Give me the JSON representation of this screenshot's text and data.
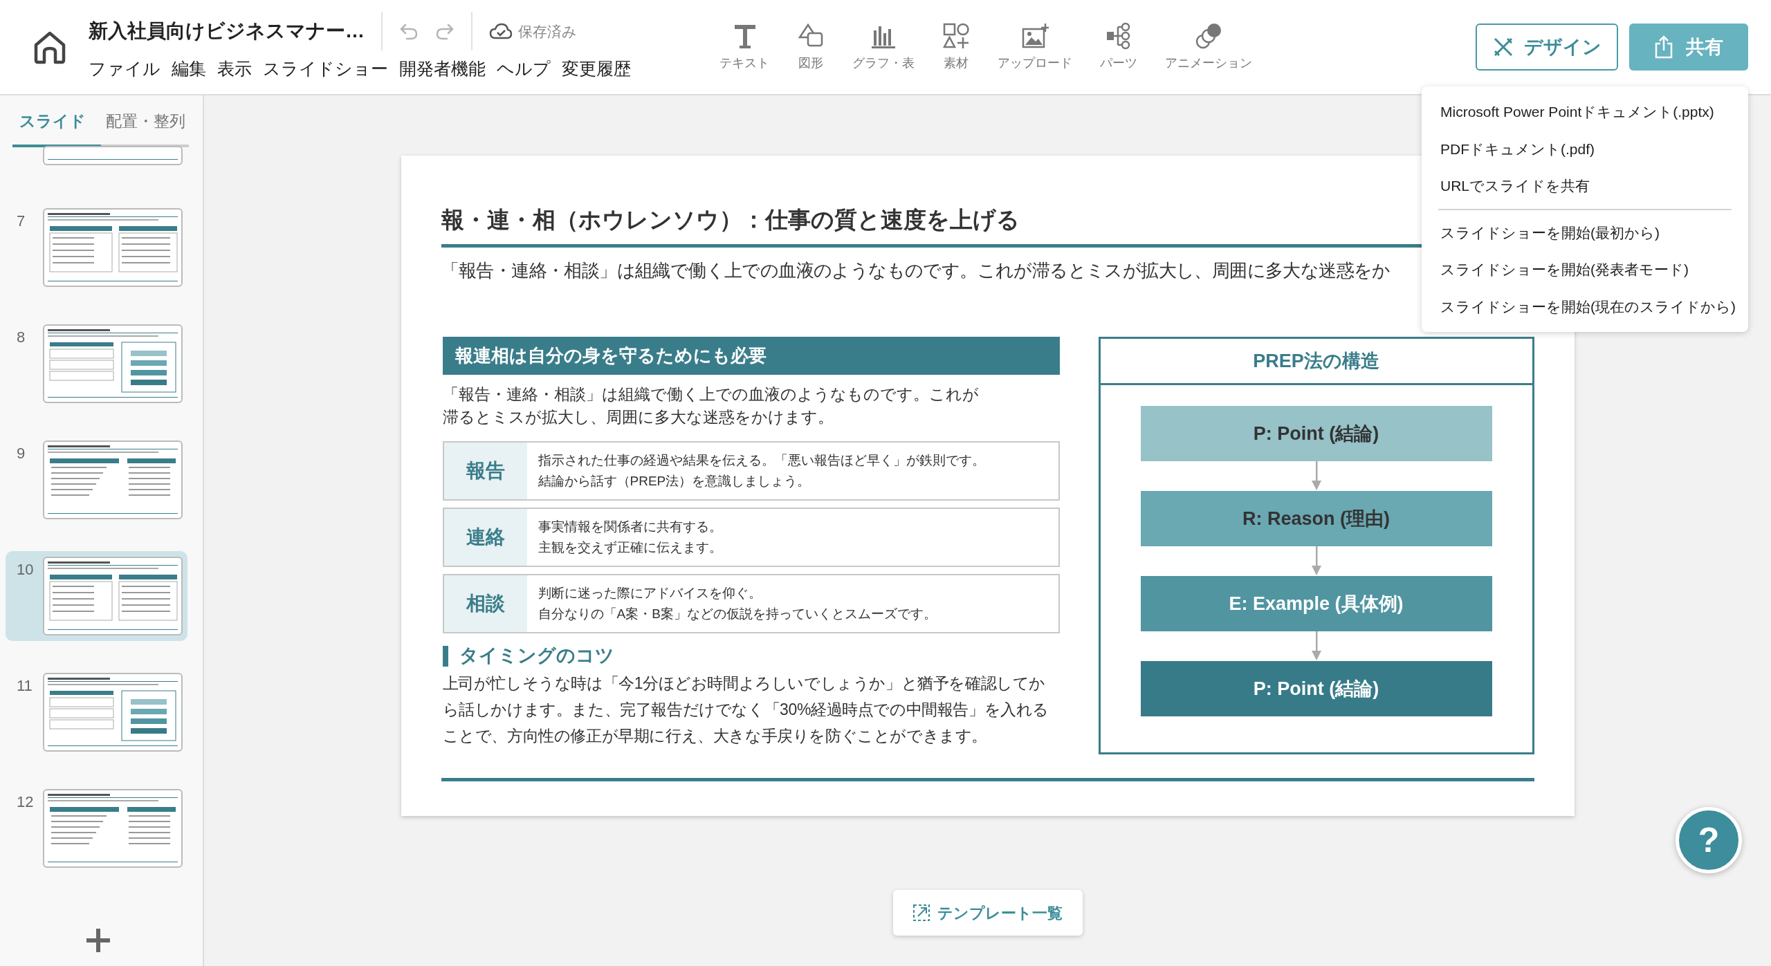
{
  "document": {
    "title": "新入社員向けビジネスマナー…",
    "save_status": "保存済み"
  },
  "menu": [
    "ファイル",
    "編集",
    "表示",
    "スライドショー",
    "開発者機能",
    "ヘルプ",
    "変更履歴"
  ],
  "tools": [
    {
      "label": "テキスト",
      "kind": "text"
    },
    {
      "label": "図形",
      "kind": "shape"
    },
    {
      "label": "グラフ・表",
      "kind": "chart"
    },
    {
      "label": "素材",
      "kind": "material"
    },
    {
      "label": "アップロード",
      "kind": "upload"
    },
    {
      "label": "パーツ",
      "kind": "parts"
    },
    {
      "label": "アニメーション",
      "kind": "animation"
    }
  ],
  "actions": {
    "design": "デザイン",
    "share": "共有"
  },
  "share_menu": {
    "groups": [
      [
        "Microsoft Power Pointドキュメント(.pptx)",
        "PDFドキュメント(.pdf)",
        "URLでスライドを共有"
      ],
      [
        "スライドショーを開始(最初から)",
        "スライドショーを開始(発表者モード)",
        "スライドショーを開始(現在のスライドから)"
      ]
    ]
  },
  "sidebar": {
    "tabs": [
      {
        "label": "スライド",
        "selected": true
      },
      {
        "label": "配置・整列",
        "selected": false
      }
    ],
    "slides": [
      {
        "selected": false
      },
      {
        "number": "7",
        "selected": false
      },
      {
        "number": "8",
        "selected": false
      },
      {
        "number": "9",
        "selected": false
      },
      {
        "number": "10",
        "selected": true
      },
      {
        "number": "11",
        "selected": false
      },
      {
        "number": "12",
        "selected": false
      }
    ]
  },
  "slide": {
    "title": "報・連・相（ホウレンソウ）：仕事の質と速度を上げる",
    "subtitle": "「報告・連絡・相談」は組織で働く上での血液のようなものです。これが滞るとミスが拡大し、周囲に多大な迷惑をか",
    "section": {
      "heading": "報連相は自分の身を守るためにも必要",
      "text": "「報告・連絡・相談」は組織で働く上での血液のようなものです。これが滞るとミスが拡大し、周囲に多大な迷惑をかけます。",
      "items": [
        {
          "label": "報告",
          "lines": [
            "指示された仕事の経過や結果を伝える。「悪い報告ほど早く」が鉄則です。",
            "結論から話す（PREP法）を意識しましょう。"
          ]
        },
        {
          "label": "連絡",
          "lines": [
            "事実情報を関係者に共有する。",
            "主観を交えず正確に伝えます。"
          ]
        },
        {
          "label": "相談",
          "lines": [
            "判断に迷った際にアドバイスを仰ぐ。",
            "自分なりの「A案・B案」などの仮説を持っていくとスムーズです。"
          ]
        }
      ]
    },
    "tips": {
      "heading": "タイミングのコツ",
      "text": "上司が忙しそうな時は「今1分ほどお時間よろしいでしょうか」と猶予を確認してから話しかけます。また、完了報告だけでなく「30%経過時点での中間報告」を入れることで、方向性の修正が早期に行え、大きな手戻りを防ぐことができます。"
    },
    "prep": {
      "title": "PREP法の構造",
      "steps": [
        {
          "label": "P: Point (結論)",
          "color": "#96c2c8"
        },
        {
          "label": "R: Reason (理由)",
          "color": "#6aa8b2"
        },
        {
          "label": "E: Example (具体例)",
          "color": "#5195a1"
        },
        {
          "label": "P: Point (結論)",
          "color": "#377b89"
        }
      ]
    }
  },
  "template_button": "テンプレート一覧",
  "help": "?"
}
